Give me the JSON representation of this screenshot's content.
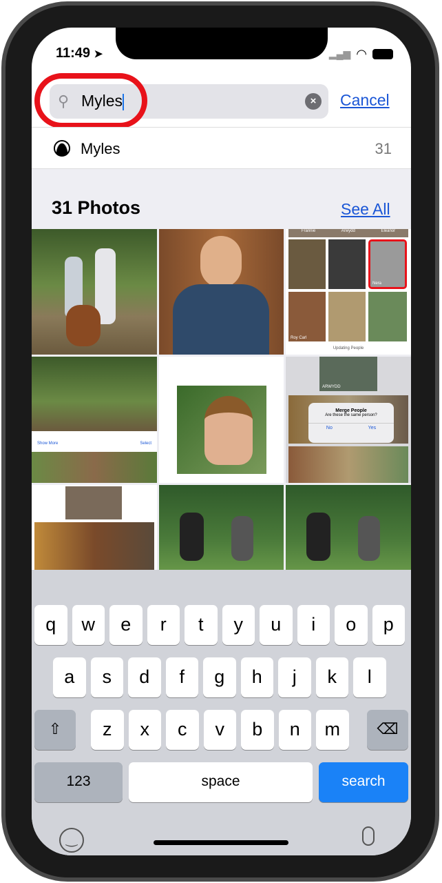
{
  "status": {
    "time": "11:49"
  },
  "search": {
    "value": "Myles",
    "cancel": "Cancel"
  },
  "suggestion": {
    "label": "Myles",
    "count": "31"
  },
  "section": {
    "title": "31 Photos",
    "see_all": "See All"
  },
  "thumb_text": {
    "names": [
      "Frannie",
      "Arwydd",
      "Eleanor",
      "Nera",
      "Roy Carl"
    ],
    "updating": "Updating People",
    "merge_title": "Merge People",
    "merge_question": "Are these the same person?",
    "no": "No",
    "yes": "Yes",
    "arwydd": "ARWYDD",
    "show_more": "Show More",
    "select": "Select"
  },
  "keyboard": {
    "row1": [
      "q",
      "w",
      "e",
      "r",
      "t",
      "y",
      "u",
      "i",
      "o",
      "p"
    ],
    "row2": [
      "a",
      "s",
      "d",
      "f",
      "g",
      "h",
      "j",
      "k",
      "l"
    ],
    "row3": [
      "z",
      "x",
      "c",
      "v",
      "b",
      "n",
      "m"
    ],
    "numbers": "123",
    "space": "space",
    "search": "search"
  },
  "colors": {
    "accent": "#1a56d6",
    "highlight": "#e8121a",
    "search_key": "#1a82f7"
  }
}
